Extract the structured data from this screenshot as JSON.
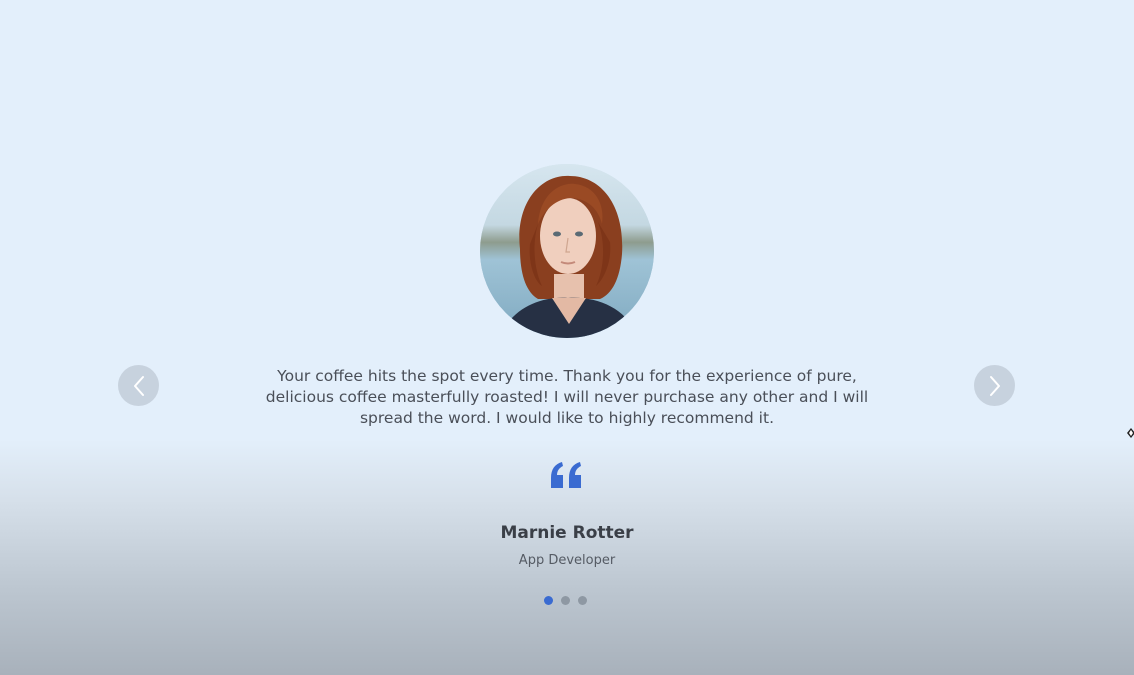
{
  "testimonial": {
    "quote": "Your coffee hits the spot every time. Thank you for the experience of pure, delicious coffee masterfully roasted! I will never purchase any other and I will spread the word. I would like to highly recommend it.",
    "author_name": "Marnie Rotter",
    "author_role": "App Developer",
    "avatar_icon": "portrait-photo"
  },
  "navigation": {
    "prev_icon": "chevron-left-icon",
    "next_icon": "chevron-right-icon"
  },
  "pagination": {
    "total": 3,
    "active_index": 0
  },
  "colors": {
    "accent": "#3a6bd1",
    "background_top": "#e3effb",
    "background_bottom": "#a8b1bb"
  }
}
